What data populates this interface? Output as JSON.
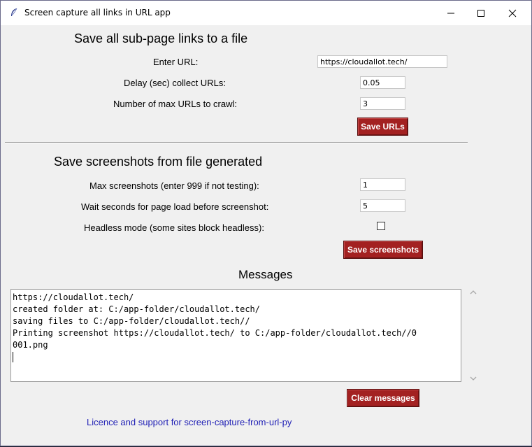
{
  "window": {
    "title": "Screen capture all links in URL app",
    "icon": "feather-icon"
  },
  "section1": {
    "heading": "Save all sub-page links to a file",
    "url_label": "Enter URL:",
    "url_value": "https://cloudallot.tech/",
    "delay_label": "Delay (sec) collect URLs:",
    "delay_value": "0.05",
    "maxurls_label": "Number of max URLs to crawl:",
    "maxurls_value": "3",
    "save_urls_button": "Save URLs"
  },
  "section2": {
    "heading": "Save screenshots from file generated",
    "max_screens_label": "Max screenshots (enter 999 if not testing):",
    "max_screens_value": "1",
    "wait_label": "Wait seconds for page load before screenshot:",
    "wait_value": "5",
    "headless_label": "Headless mode (some sites block headless):",
    "headless_checked": false,
    "save_screens_button": "Save screenshots"
  },
  "messages": {
    "heading": "Messages",
    "lines": [
      "https://cloudallot.tech/",
      "created folder at: C:/app-folder/cloudallot.tech/",
      "saving files to C:/app-folder/cloudallot.tech//",
      "Printing screenshot https://cloudallot.tech/ to C:/app-folder/cloudallot.tech//0",
      "001.png"
    ],
    "clear_button": "Clear messages"
  },
  "footer": {
    "link_text": "Licence and support for screen-capture-from-url-py"
  },
  "colors": {
    "button_bg": "#a32121",
    "link": "#1f1fb5",
    "window_bg": "#f0f0f0"
  }
}
